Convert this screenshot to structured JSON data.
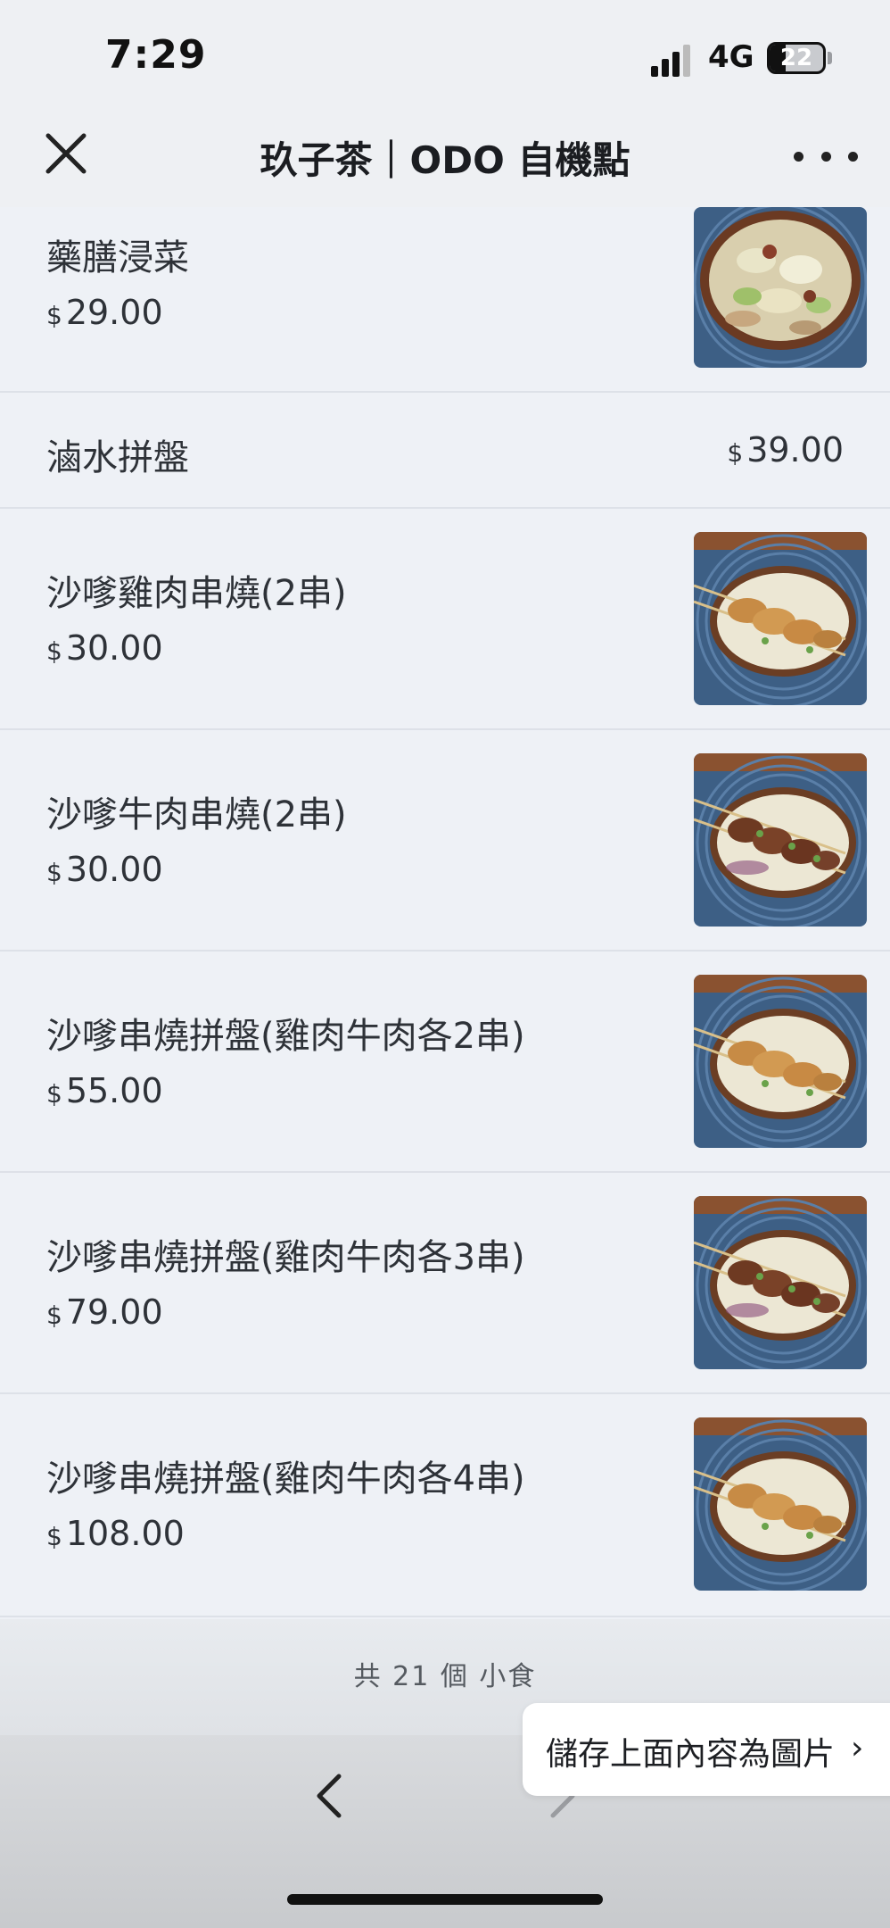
{
  "status": {
    "time": "7:29",
    "network": "4G",
    "battery": "22"
  },
  "nav": {
    "title": "玖子茶｜ODO 自機點"
  },
  "currency_symbol": "$",
  "items": [
    {
      "name": "藥膳浸菜",
      "price": "29.00",
      "image": "vegetable-soup-bowl"
    },
    {
      "name": "滷水拼盤",
      "price": "39.00",
      "image": ""
    },
    {
      "name": "沙嗲雞肉串燒(2串)",
      "price": "30.00",
      "image": "chicken-satay-skewers"
    },
    {
      "name": "沙嗲牛肉串燒(2串)",
      "price": "30.00",
      "image": "beef-satay-skewers"
    },
    {
      "name": "沙嗲串燒拼盤(雞肉牛肉各2串)",
      "price": "55.00",
      "image": "chicken-satay-skewers"
    },
    {
      "name": "沙嗲串燒拼盤(雞肉牛肉各3串)",
      "price": "79.00",
      "image": "beef-satay-skewers"
    },
    {
      "name": "沙嗲串燒拼盤(雞肉牛肉各4串)",
      "price": "108.00",
      "image": "chicken-satay-skewers"
    }
  ],
  "footer": {
    "count_text": "共 21 個 小食"
  },
  "save_prompt": {
    "label": "儲存上面內容為圖片",
    "chevron": "›"
  },
  "icons": {
    "close": "close-icon",
    "more": "more-icon",
    "back": "back-arrow-icon",
    "forward": "forward-arrow-icon"
  }
}
